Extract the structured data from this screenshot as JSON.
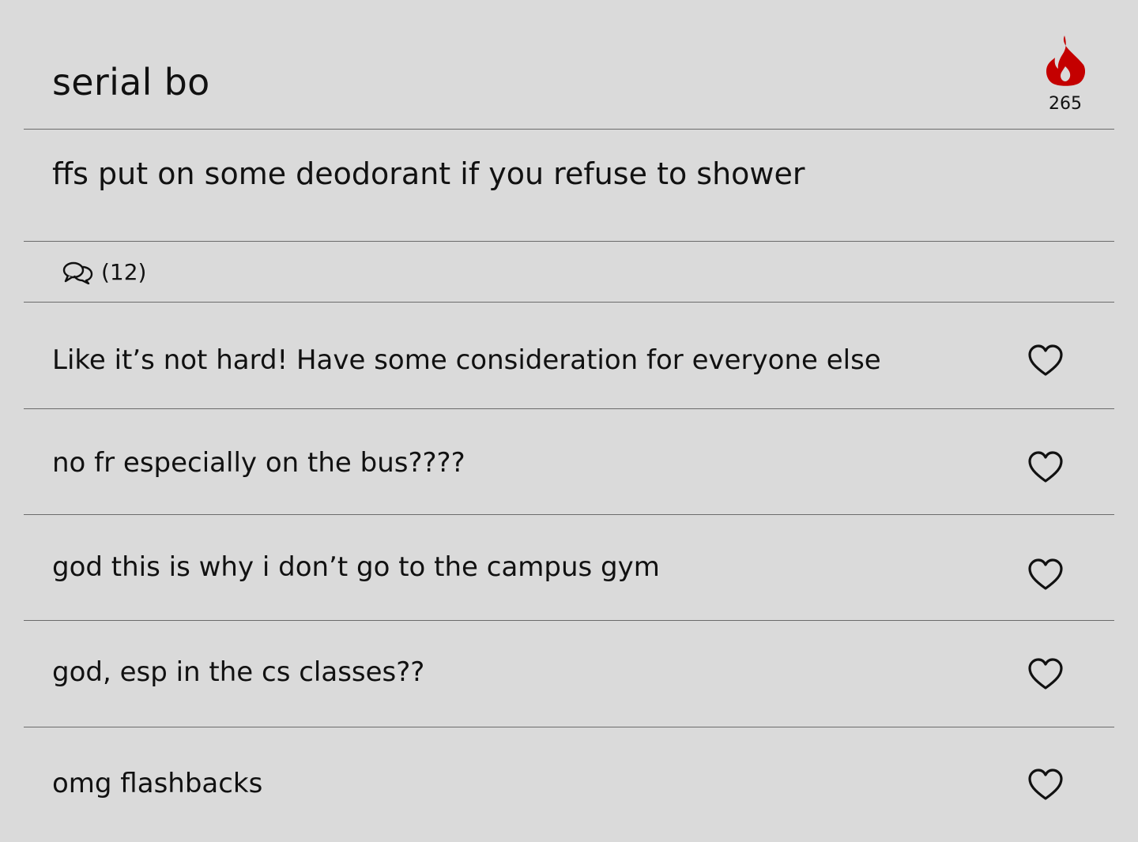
{
  "post": {
    "title": "serial bo",
    "score": "265",
    "body": "ffs put on some deodorant if you refuse to shower",
    "comment_count": "(12)"
  },
  "comments": [
    {
      "text": "Like it’s not hard! Have some consideration for everyone else"
    },
    {
      "text": "no fr especially on the bus????"
    },
    {
      "text": "god this is why i don’t go to the campus gym"
    },
    {
      "text": "god, esp in the cs classes??"
    },
    {
      "text": "omg flashbacks"
    }
  ],
  "colors": {
    "background": "#dadada",
    "flame": "#c40000",
    "divider": "#6b6b6b"
  },
  "icons": {
    "score": "flame-icon",
    "comments": "speech-bubbles-icon",
    "like": "heart-outline-icon"
  }
}
